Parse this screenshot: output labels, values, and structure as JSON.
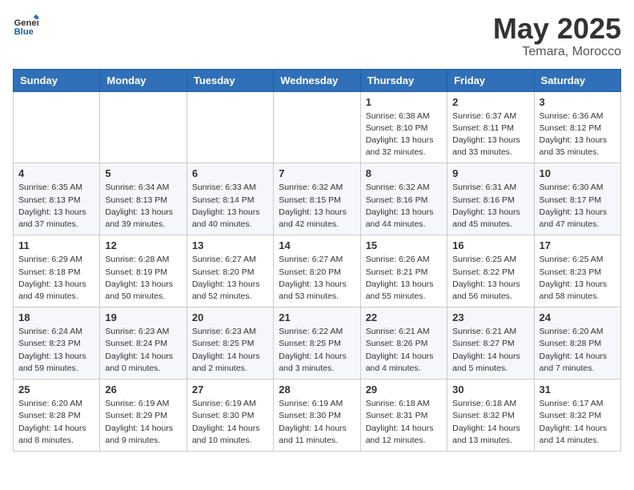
{
  "header": {
    "logo_general": "General",
    "logo_blue": "Blue",
    "title": "May 2025",
    "subtitle": "Temara, Morocco"
  },
  "weekdays": [
    "Sunday",
    "Monday",
    "Tuesday",
    "Wednesday",
    "Thursday",
    "Friday",
    "Saturday"
  ],
  "weeks": [
    [
      {
        "day": "",
        "info": ""
      },
      {
        "day": "",
        "info": ""
      },
      {
        "day": "",
        "info": ""
      },
      {
        "day": "",
        "info": ""
      },
      {
        "day": "1",
        "info": "Sunrise: 6:38 AM\nSunset: 8:10 PM\nDaylight: 13 hours\nand 32 minutes."
      },
      {
        "day": "2",
        "info": "Sunrise: 6:37 AM\nSunset: 8:11 PM\nDaylight: 13 hours\nand 33 minutes."
      },
      {
        "day": "3",
        "info": "Sunrise: 6:36 AM\nSunset: 8:12 PM\nDaylight: 13 hours\nand 35 minutes."
      }
    ],
    [
      {
        "day": "4",
        "info": "Sunrise: 6:35 AM\nSunset: 8:13 PM\nDaylight: 13 hours\nand 37 minutes."
      },
      {
        "day": "5",
        "info": "Sunrise: 6:34 AM\nSunset: 8:13 PM\nDaylight: 13 hours\nand 39 minutes."
      },
      {
        "day": "6",
        "info": "Sunrise: 6:33 AM\nSunset: 8:14 PM\nDaylight: 13 hours\nand 40 minutes."
      },
      {
        "day": "7",
        "info": "Sunrise: 6:32 AM\nSunset: 8:15 PM\nDaylight: 13 hours\nand 42 minutes."
      },
      {
        "day": "8",
        "info": "Sunrise: 6:32 AM\nSunset: 8:16 PM\nDaylight: 13 hours\nand 44 minutes."
      },
      {
        "day": "9",
        "info": "Sunrise: 6:31 AM\nSunset: 8:16 PM\nDaylight: 13 hours\nand 45 minutes."
      },
      {
        "day": "10",
        "info": "Sunrise: 6:30 AM\nSunset: 8:17 PM\nDaylight: 13 hours\nand 47 minutes."
      }
    ],
    [
      {
        "day": "11",
        "info": "Sunrise: 6:29 AM\nSunset: 8:18 PM\nDaylight: 13 hours\nand 49 minutes."
      },
      {
        "day": "12",
        "info": "Sunrise: 6:28 AM\nSunset: 8:19 PM\nDaylight: 13 hours\nand 50 minutes."
      },
      {
        "day": "13",
        "info": "Sunrise: 6:27 AM\nSunset: 8:20 PM\nDaylight: 13 hours\nand 52 minutes."
      },
      {
        "day": "14",
        "info": "Sunrise: 6:27 AM\nSunset: 8:20 PM\nDaylight: 13 hours\nand 53 minutes."
      },
      {
        "day": "15",
        "info": "Sunrise: 6:26 AM\nSunset: 8:21 PM\nDaylight: 13 hours\nand 55 minutes."
      },
      {
        "day": "16",
        "info": "Sunrise: 6:25 AM\nSunset: 8:22 PM\nDaylight: 13 hours\nand 56 minutes."
      },
      {
        "day": "17",
        "info": "Sunrise: 6:25 AM\nSunset: 8:23 PM\nDaylight: 13 hours\nand 58 minutes."
      }
    ],
    [
      {
        "day": "18",
        "info": "Sunrise: 6:24 AM\nSunset: 8:23 PM\nDaylight: 13 hours\nand 59 minutes."
      },
      {
        "day": "19",
        "info": "Sunrise: 6:23 AM\nSunset: 8:24 PM\nDaylight: 14 hours\nand 0 minutes."
      },
      {
        "day": "20",
        "info": "Sunrise: 6:23 AM\nSunset: 8:25 PM\nDaylight: 14 hours\nand 2 minutes."
      },
      {
        "day": "21",
        "info": "Sunrise: 6:22 AM\nSunset: 8:25 PM\nDaylight: 14 hours\nand 3 minutes."
      },
      {
        "day": "22",
        "info": "Sunrise: 6:21 AM\nSunset: 8:26 PM\nDaylight: 14 hours\nand 4 minutes."
      },
      {
        "day": "23",
        "info": "Sunrise: 6:21 AM\nSunset: 8:27 PM\nDaylight: 14 hours\nand 5 minutes."
      },
      {
        "day": "24",
        "info": "Sunrise: 6:20 AM\nSunset: 8:28 PM\nDaylight: 14 hours\nand 7 minutes."
      }
    ],
    [
      {
        "day": "25",
        "info": "Sunrise: 6:20 AM\nSunset: 8:28 PM\nDaylight: 14 hours\nand 8 minutes."
      },
      {
        "day": "26",
        "info": "Sunrise: 6:19 AM\nSunset: 8:29 PM\nDaylight: 14 hours\nand 9 minutes."
      },
      {
        "day": "27",
        "info": "Sunrise: 6:19 AM\nSunset: 8:30 PM\nDaylight: 14 hours\nand 10 minutes."
      },
      {
        "day": "28",
        "info": "Sunrise: 6:19 AM\nSunset: 8:30 PM\nDaylight: 14 hours\nand 11 minutes."
      },
      {
        "day": "29",
        "info": "Sunrise: 6:18 AM\nSunset: 8:31 PM\nDaylight: 14 hours\nand 12 minutes."
      },
      {
        "day": "30",
        "info": "Sunrise: 6:18 AM\nSunset: 8:32 PM\nDaylight: 14 hours\nand 13 minutes."
      },
      {
        "day": "31",
        "info": "Sunrise: 6:17 AM\nSunset: 8:32 PM\nDaylight: 14 hours\nand 14 minutes."
      }
    ]
  ]
}
